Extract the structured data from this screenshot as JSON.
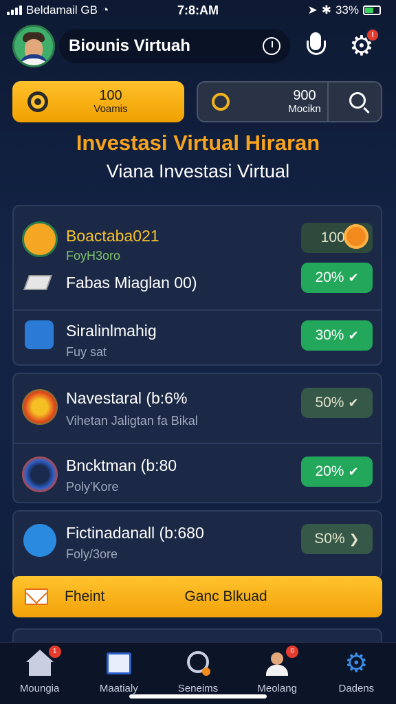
{
  "status_bar": {
    "carrier": "Beldamail GB",
    "time": "7:8:AM",
    "battery": "33%"
  },
  "header": {
    "title": "Biounis Virtuah"
  },
  "stats": [
    {
      "value": "100",
      "label": "Voamis"
    },
    {
      "value": "900",
      "label": "Mocikn"
    }
  ],
  "headline": "Investasi Virtual Hiraran",
  "subline": "Viana Investasi Virtual",
  "list": [
    {
      "name": "Boactaba021",
      "sub": "FoyH3oro",
      "pill": "1003"
    },
    {
      "name": "Fabas Miaglan 00)",
      "sub": "",
      "pill": "20%"
    },
    {
      "name": "Siralinlmahig",
      "sub": "Fuy sat",
      "pill": "30%"
    },
    {
      "name": "Navestaral (b:6%",
      "sub": "Vihetan Jaligtan fa Bikal",
      "pill": "50%"
    },
    {
      "name": "Bncktman (b:80",
      "sub": "Poly'Kore",
      "pill": "20%"
    },
    {
      "name": "Fictinadanall (b:680",
      "sub": "Foly/3ore",
      "pill": "S0%"
    }
  ],
  "banner": {
    "left": "Fheint",
    "right": "Ganc Blkuad"
  },
  "nav": [
    {
      "label": "Moungia",
      "badge": "1"
    },
    {
      "label": "Maatialy",
      "badge": ""
    },
    {
      "label": "Seneims",
      "badge": ""
    },
    {
      "label": "Meolang",
      "badge": "0"
    },
    {
      "label": "Dadens",
      "badge": ""
    }
  ],
  "colors": {
    "accent": "#f6a31e",
    "green": "#22a75b",
    "bg": "#132447"
  }
}
